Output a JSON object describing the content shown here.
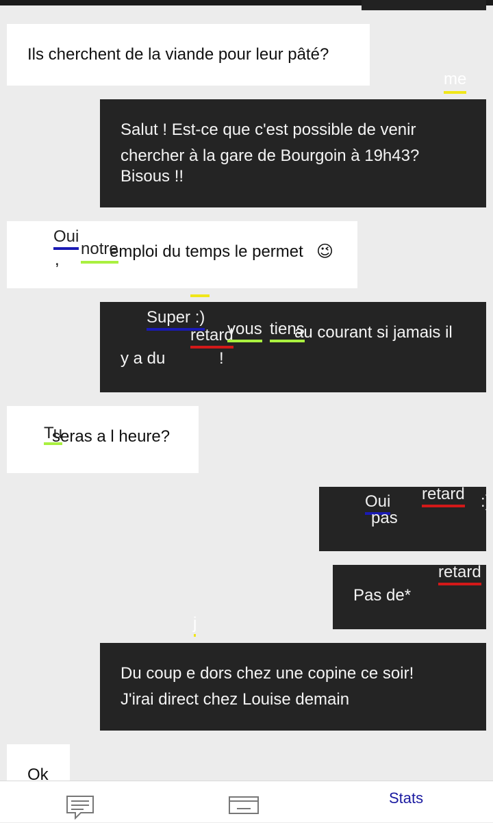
{
  "colors": {
    "incoming_bg": "#ffffff",
    "outgoing_bg": "#242424",
    "blue": "#1a1ab4",
    "red": "#d21919",
    "green": "#aaf040",
    "yellow": "#f0e619"
  },
  "sender_label": "me",
  "messages": [
    {
      "id": "m1",
      "dir": "in",
      "text": "Ils cherchent de la viande pour leur pâté?"
    },
    {
      "id": "m2",
      "dir": "out",
      "line1": "Salut ! Est-ce que c'est possible de venir",
      "line2": "chercher à la gare de Bourgoin à 19h43?",
      "line3": "Bisous !!"
    },
    {
      "id": "m3",
      "dir": "in",
      "comma": ",",
      "text": "emploi du temps le permet",
      "emoji": "😉",
      "corrections": {
        "oui": "Oui",
        "notre": "notre"
      }
    },
    {
      "id": "m4",
      "dir": "out",
      "line1": "au courant si jamais il",
      "line2a": "y a du",
      "line2b": "!",
      "corrections": {
        "super": "Super :)",
        "retard": "retard",
        "vous": "vous",
        "tiens": "tiens"
      }
    },
    {
      "id": "m5",
      "dir": "in",
      "text": "seras a l heure?",
      "corrections": {
        "tu": "Tu"
      }
    },
    {
      "id": "m6",
      "dir": "out",
      "corrections": {
        "oui": "Oui",
        "pas": "pas",
        "retard": "retard",
        "smile": ":)"
      }
    },
    {
      "id": "m7",
      "dir": "out",
      "text": "Pas de*",
      "corrections": {
        "retard": "retard"
      }
    },
    {
      "id": "m8",
      "dir": "out",
      "line1": "Du coup  e dors chez une copine ce soir!",
      "line2": "J'irai direct chez Louise demain",
      "corrections": {
        "j": "j"
      }
    },
    {
      "id": "m9",
      "dir": "in",
      "text": "Ok"
    }
  ],
  "bottom_nav": {
    "items": [
      {
        "icon": "chat-icon"
      },
      {
        "icon": "keyboard-icon"
      },
      {
        "label": "Stats"
      }
    ]
  }
}
